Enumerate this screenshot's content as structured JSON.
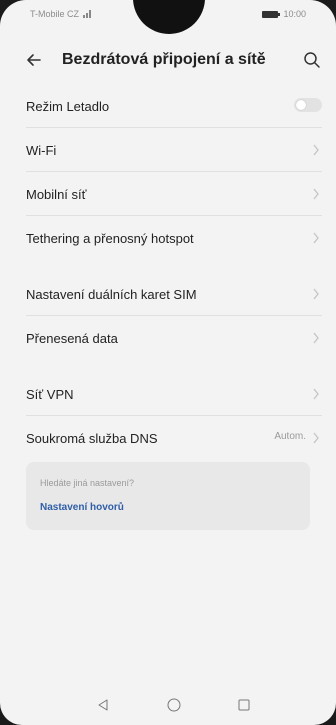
{
  "status_bar": {
    "carrier": "T-Mobile CZ",
    "time": "10:00"
  },
  "header": {
    "title": "Bezdrátová připojení a sítě",
    "back_icon": "arrow-left-icon",
    "search_icon": "search-icon"
  },
  "settings": {
    "airplane": {
      "label": "Režim Letadlo",
      "enabled": false
    },
    "wifi": {
      "label": "Wi-Fi"
    },
    "mobile": {
      "label": "Mobilní síť"
    },
    "tethering": {
      "label": "Tethering a přenosný hotspot"
    },
    "dual_sim": {
      "label": "Nastavení duálních karet SIM"
    },
    "data": {
      "label": "Přenesená data"
    },
    "vpn": {
      "label": "Síť VPN"
    },
    "dns": {
      "label": "Soukromá služba DNS",
      "value": "Autom."
    }
  },
  "suggestion": {
    "hint": "Hledáte jiná nastavení?",
    "link": "Nastavení hovorů"
  },
  "colors": {
    "background": "#f3f3f3",
    "link": "#2f5ea8",
    "divider": "#e0e0e0"
  }
}
